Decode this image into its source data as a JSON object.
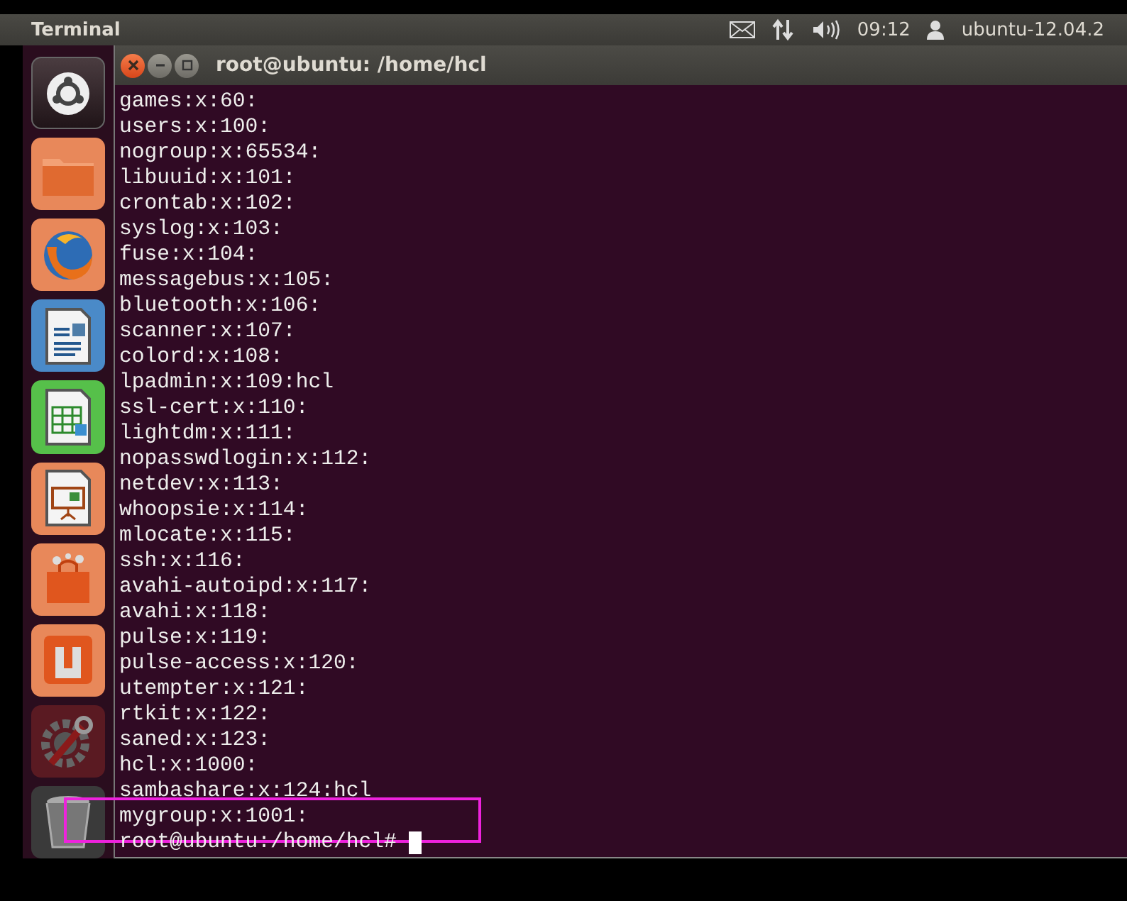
{
  "top_panel": {
    "app_title": "Terminal",
    "clock": "09:12",
    "user": "ubuntu-12.04.2"
  },
  "launcher": {
    "items": [
      {
        "kind": "dash"
      },
      {
        "kind": "files"
      },
      {
        "kind": "browser"
      },
      {
        "kind": "writer"
      },
      {
        "kind": "calc"
      },
      {
        "kind": "impress"
      },
      {
        "kind": "software-center"
      },
      {
        "kind": "ubuntu-one"
      },
      {
        "kind": "settings"
      },
      {
        "kind": "trash"
      }
    ]
  },
  "window": {
    "title": "root@ubuntu: /home/hcl",
    "lines": [
      "games:x:60:",
      "users:x:100:",
      "nogroup:x:65534:",
      "libuuid:x:101:",
      "crontab:x:102:",
      "syslog:x:103:",
      "fuse:x:104:",
      "messagebus:x:105:",
      "bluetooth:x:106:",
      "scanner:x:107:",
      "colord:x:108:",
      "lpadmin:x:109:hcl",
      "ssl-cert:x:110:",
      "lightdm:x:111:",
      "nopasswdlogin:x:112:",
      "netdev:x:113:",
      "whoopsie:x:114:",
      "mlocate:x:115:",
      "ssh:x:116:",
      "avahi-autoipd:x:117:",
      "avahi:x:118:",
      "pulse:x:119:",
      "pulse-access:x:120:",
      "utempter:x:121:",
      "rtkit:x:122:",
      "saned:x:123:",
      "hcl:x:1000:",
      "sambashare:x:124:hcl",
      "mygroup:x:1001:"
    ],
    "prompt": "root@ubuntu:/home/hcl#"
  }
}
